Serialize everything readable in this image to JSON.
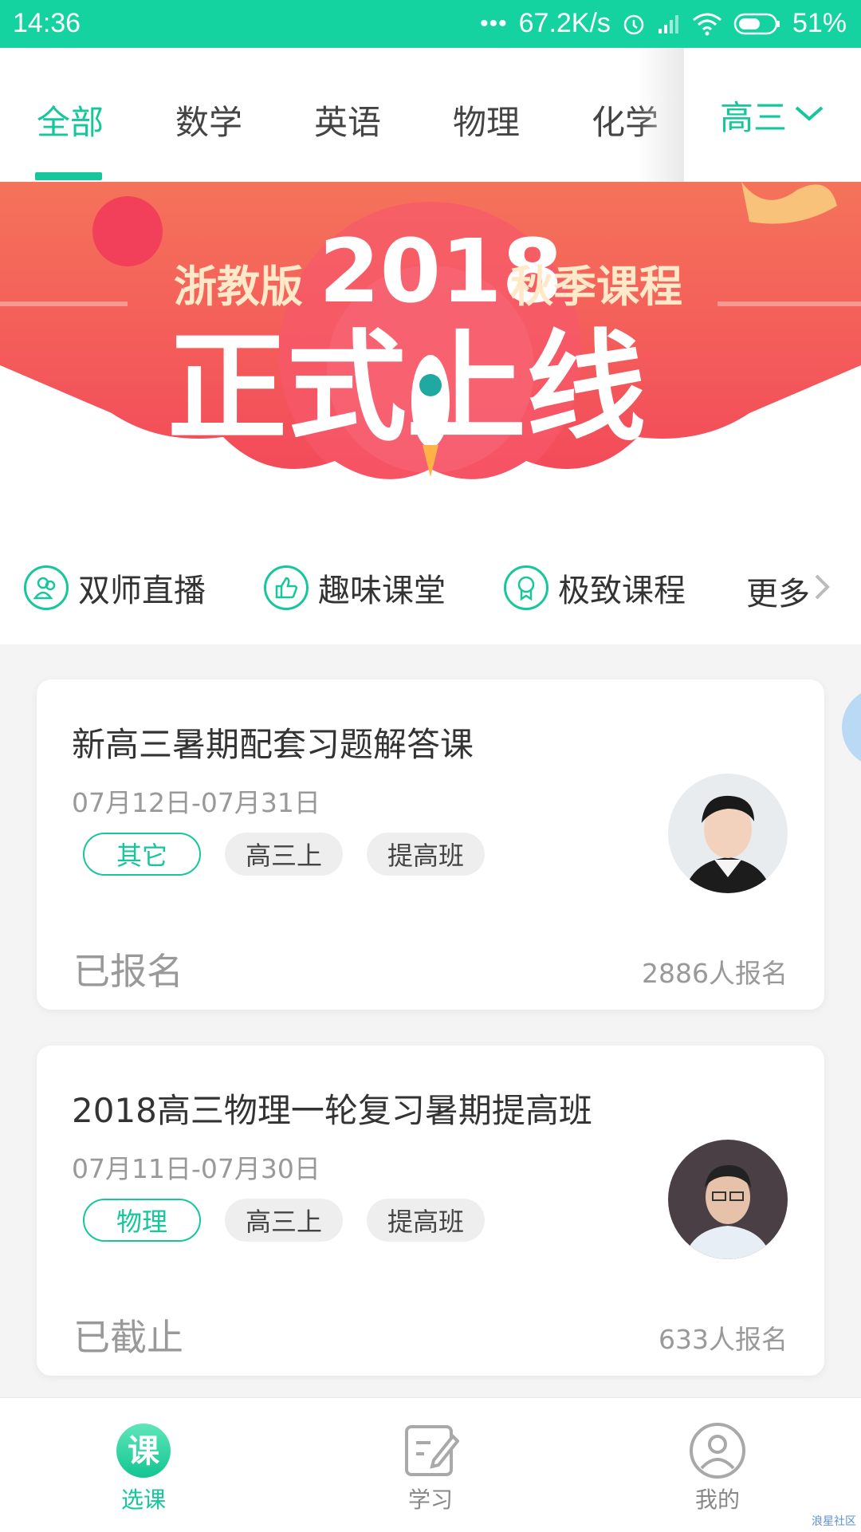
{
  "status_bar": {
    "time": "14:36",
    "speed": "67.2K/s",
    "battery": "51%"
  },
  "tabs": [
    {
      "label": "全部",
      "active": true
    },
    {
      "label": "数学"
    },
    {
      "label": "英语"
    },
    {
      "label": "物理"
    },
    {
      "label": "化学"
    }
  ],
  "grade_selector": {
    "label": "高三"
  },
  "banner": {
    "line1_left": "浙教版",
    "year": "2018",
    "line1_right": "秋季课程",
    "line2": "正式上线"
  },
  "quick_links": [
    {
      "label": "双师直播",
      "icon": "two-teachers-icon"
    },
    {
      "label": "趣味课堂",
      "icon": "thumbs-up-icon"
    },
    {
      "label": "极致课程",
      "icon": "award-icon"
    }
  ],
  "more_label": "更多",
  "courses": [
    {
      "title": "新高三暑期配套习题解答课",
      "date": "07月12日-07月31日",
      "tags": [
        "其它",
        "高三上",
        "提高班"
      ],
      "status": "已报名",
      "enroll_count": "2886人报名"
    },
    {
      "title": "2018高三物理一轮复习暑期提高班",
      "date": "07月11日-07月30日",
      "tags": [
        "物理",
        "高三上",
        "提高班"
      ],
      "status": "已截止",
      "enroll_count": "633人报名"
    }
  ],
  "bottom_nav": [
    {
      "label": "选课",
      "icon_text": "课",
      "active": true
    },
    {
      "label": "学习"
    },
    {
      "label": "我的"
    }
  ],
  "watermark": "浪星社区",
  "colors": {
    "accent": "#15c79a",
    "status_bar": "#15d3a0",
    "banner_red": "#f2435a"
  }
}
